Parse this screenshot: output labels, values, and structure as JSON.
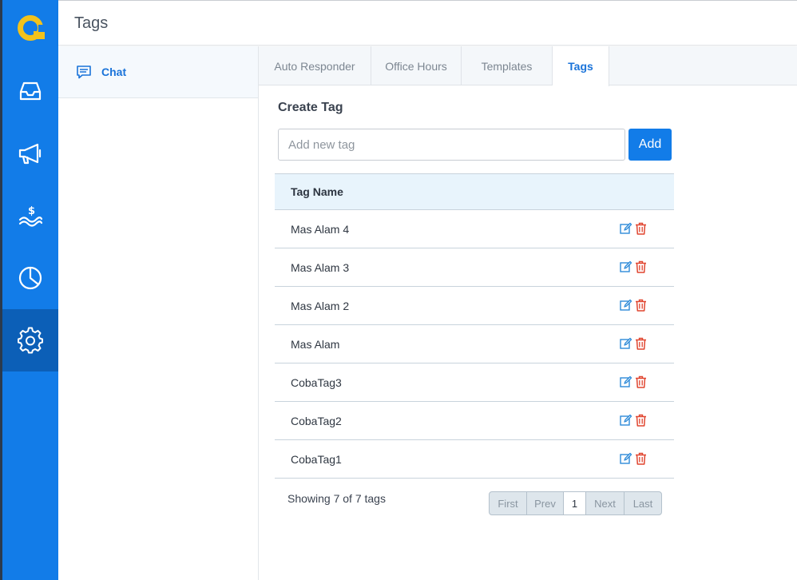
{
  "app": {
    "accent_color": "#127ce8",
    "logo_color": "#f2c21b"
  },
  "rail": {
    "items": [
      {
        "icon": "inbox-icon"
      },
      {
        "icon": "megaphone-icon"
      },
      {
        "icon": "billing-icon"
      },
      {
        "icon": "pie-chart-icon"
      },
      {
        "icon": "gear-icon",
        "active": true
      }
    ]
  },
  "header": {
    "title": "Tags"
  },
  "subnav": {
    "items": [
      {
        "label": "Chat",
        "icon": "chat-icon",
        "active": true
      }
    ]
  },
  "tabs": [
    {
      "label": "Auto Responder"
    },
    {
      "label": "Office Hours"
    },
    {
      "label": "Templates"
    },
    {
      "label": "Tags",
      "active": true
    }
  ],
  "create": {
    "title": "Create Tag",
    "placeholder": "Add new tag",
    "value": "",
    "add_label": "Add"
  },
  "table": {
    "header": "Tag Name",
    "rows": [
      {
        "name": "Mas Alam 4"
      },
      {
        "name": "Mas Alam 3"
      },
      {
        "name": "Mas Alam 2"
      },
      {
        "name": "Mas Alam"
      },
      {
        "name": "CobaTag3"
      },
      {
        "name": "CobaTag2"
      },
      {
        "name": "CobaTag1"
      }
    ],
    "row_icons": {
      "edit": "edit-icon",
      "delete": "trash-icon",
      "edit_color": "#2d8ad8",
      "delete_color": "#e0452f"
    }
  },
  "footer": {
    "showing_text": "Showing 7 of 7 tags",
    "pagination": {
      "first": "First",
      "prev": "Prev",
      "current": "1",
      "next": "Next",
      "last": "Last"
    }
  }
}
